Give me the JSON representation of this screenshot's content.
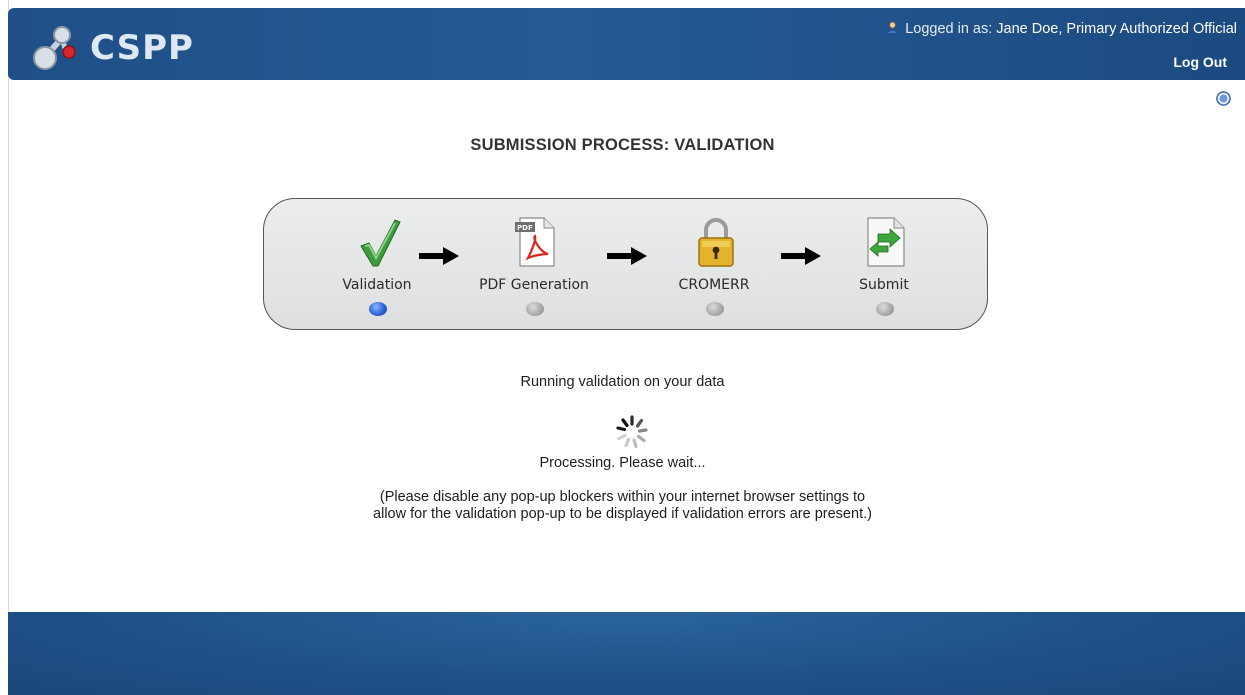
{
  "app": {
    "logo_text": "CSPP"
  },
  "header": {
    "logged_in_prefix": "Logged in as:",
    "user_name": "Jane Doe, Primary Authorized Official",
    "logout_label": "Log Out"
  },
  "page": {
    "title": "SUBMISSION PROCESS: VALIDATION"
  },
  "steps": [
    {
      "label": "Validation",
      "icon": "checkmark-icon",
      "status": "active"
    },
    {
      "label": "PDF Generation",
      "icon": "pdf-icon",
      "status": "pending"
    },
    {
      "label": "CROMERR",
      "icon": "lock-icon",
      "status": "pending"
    },
    {
      "label": "Submit",
      "icon": "submit-document-icon",
      "status": "pending"
    }
  ],
  "status": {
    "running": "Running validation on your data",
    "processing": "Processing. Please wait...",
    "note_line1": "(Please disable any pop-up blockers within your internet browser settings to",
    "note_line2": "allow for the validation pop-up to be displayed if validation errors are present.)"
  },
  "colors": {
    "header_blue": "#245a96",
    "active_dot": "#2b63d6",
    "idle_dot": "#a7a7a7"
  }
}
